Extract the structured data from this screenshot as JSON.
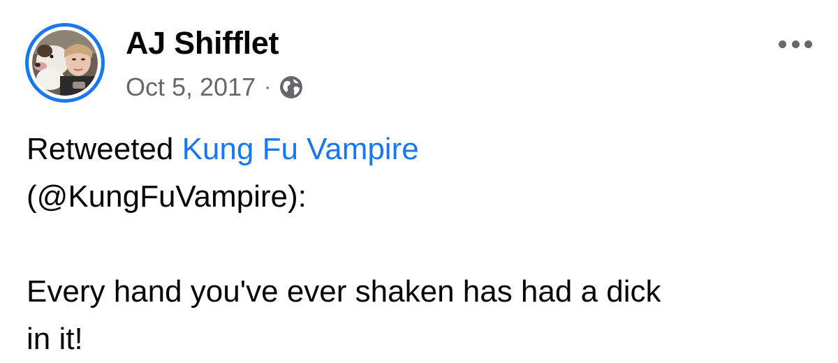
{
  "post": {
    "author": "AJ Shifflet",
    "date": "Oct 5, 2017",
    "separator": "·",
    "privacy_icon": "globe-icon",
    "more_icon": "ellipsis-icon",
    "retweet_prefix": "Retweeted ",
    "retweet_name": "Kung Fu Vampire",
    "retweet_handle": "(@KungFuVampire):",
    "body_line1": "Every hand you've ever shaken has had a dick",
    "body_line2": "in it!"
  },
  "colors": {
    "link": "#1877f2",
    "avatar_ring": "#1877f2",
    "meta_text": "#65676b",
    "main_text": "#050505"
  }
}
